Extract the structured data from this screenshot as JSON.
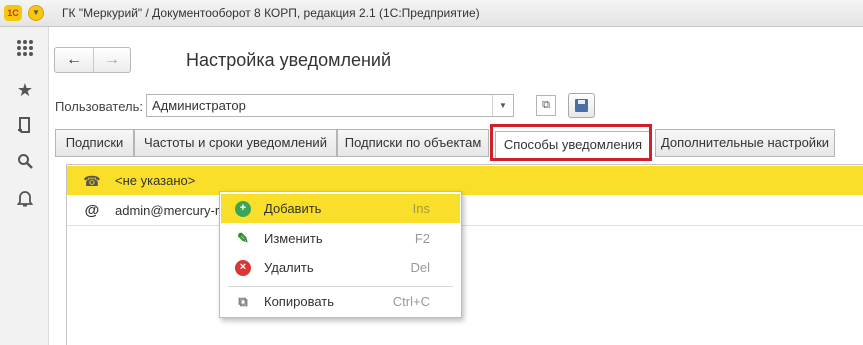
{
  "window": {
    "logo_text": "1С",
    "title": "ГК \"Меркурий\" / Документооборот 8 КОРП, редакция 2.1  (1С:Предприятие)"
  },
  "leftbar": {
    "icons": [
      "apps-grid-icon",
      "star-icon",
      "history-icon",
      "search-icon",
      "bell-icon"
    ]
  },
  "nav": {
    "back": "←",
    "forward": "→"
  },
  "form": {
    "title": "Настройка уведомлений",
    "user_label": "Пользователь:",
    "user_value": "Администратор"
  },
  "tabs": [
    {
      "label": "Подписки",
      "active": false
    },
    {
      "label": "Частоты и сроки уведомлений",
      "active": false
    },
    {
      "label": "Подписки по объектам",
      "active": false
    },
    {
      "label": "Способы уведомления",
      "active": true
    },
    {
      "label": "Дополнительные настройки",
      "active": false
    }
  ],
  "rows": [
    {
      "icon": "phone-icon",
      "text": "<не указано>",
      "selected": true
    },
    {
      "icon": "at-sign-icon",
      "text": "admin@mercury-r",
      "selected": false
    }
  ],
  "context_menu": [
    {
      "label": "Добавить",
      "shortcut": "Ins",
      "icon": "add-icon"
    },
    {
      "label": "Изменить",
      "shortcut": "F2",
      "icon": "pencil-icon"
    },
    {
      "label": "Удалить",
      "shortcut": "Del",
      "icon": "delete-icon"
    },
    {
      "label": "Копировать",
      "shortcut": "Ctrl+C",
      "icon": "copy-icon"
    }
  ],
  "colors": {
    "highlight": "#f9df2a",
    "callout": "#d0202a"
  }
}
